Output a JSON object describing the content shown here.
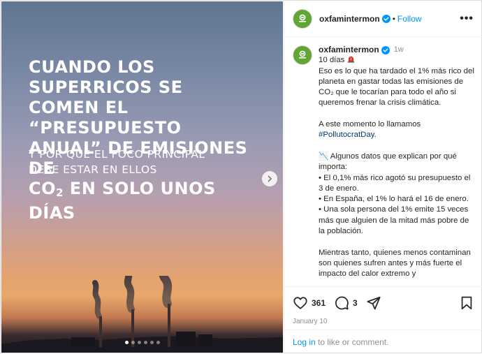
{
  "post": {
    "slides": {
      "count": 6,
      "active_index": 0
    },
    "image_text": {
      "headline_line1": "Cuando los superricos se",
      "headline_line2": "comen el “presupuesto",
      "headline_line3": "anual” de emisiones de",
      "headline_co": "CO",
      "headline_sub": "2",
      "headline_tail": " en solo unos días",
      "subhead_line1": "Y por qué el foco principal",
      "subhead_line2": "debe estar en ellos"
    }
  },
  "header": {
    "username": "oxfamintermon",
    "separator": "•",
    "follow_label": "Follow",
    "more_label": "•••"
  },
  "caption": {
    "username": "oxfamintermon",
    "time_ago": "1w",
    "days_line": "10 días",
    "para1": "Eso es lo que ha tardado el 1% más rico del planeta en gastar todas las emisiones de CO₂ que le tocarían para todo el año si queremos frenar la crisis climática.",
    "para2_text": "A este momento lo llamamos ",
    "para2_hashtag": "#PollutocratDay",
    "para2_end": ".",
    "para3_title": "📉 Algunos datos que explican por qué importa:",
    "bullet1": "• El 0,1% más rico agotó su presupuesto el 3 de enero.",
    "bullet2": "• En España, el 1% lo hará el 16 de enero.",
    "bullet3": "• Una sola persona del 1% emite 15 veces más que alguien de la mitad más pobre de la población.",
    "para4": "Mientras tanto, quienes menos contaminan son quienes sufren antes y más fuerte el impacto del calor extremo y"
  },
  "actions": {
    "likes": "361",
    "comments": "3",
    "date": "January 10"
  },
  "login": {
    "link": "Log in",
    "rest": " to like or comment."
  },
  "colors": {
    "brand_green": "#61a534",
    "link_blue": "#0095f6",
    "verified_blue": "#0095f6"
  }
}
